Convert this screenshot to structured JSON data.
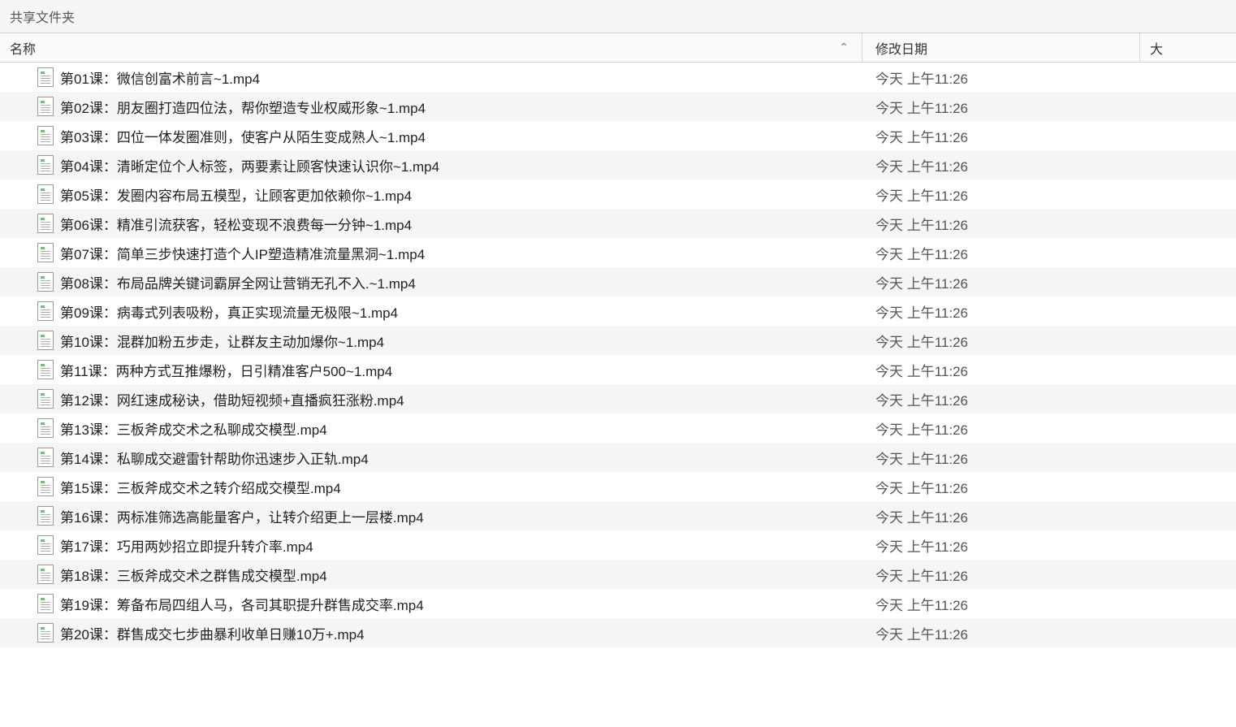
{
  "header": {
    "title": "共享文件夹"
  },
  "columns": {
    "name": "名称",
    "date": "修改日期",
    "size": "大",
    "sort": "⌃"
  },
  "files": [
    {
      "name": "第01课：微信创富术前言~1.mp4",
      "date": "今天 上午11:26"
    },
    {
      "name": "第02课：朋友圈打造四位法，帮你塑造专业权威形象~1.mp4",
      "date": "今天 上午11:26"
    },
    {
      "name": "第03课：四位一体发圈准则，使客户从陌生变成熟人~1.mp4",
      "date": "今天 上午11:26"
    },
    {
      "name": "第04课：清晰定位个人标签，两要素让顾客快速认识你~1.mp4",
      "date": "今天 上午11:26"
    },
    {
      "name": "第05课：发圈内容布局五模型，让顾客更加依赖你~1.mp4",
      "date": "今天 上午11:26"
    },
    {
      "name": "第06课：精准引流获客，轻松变现不浪费每一分钟~1.mp4",
      "date": "今天 上午11:26"
    },
    {
      "name": "第07课：简单三步快速打造个人IP塑造精准流量黑洞~1.mp4",
      "date": "今天 上午11:26"
    },
    {
      "name": "第08课：布局品牌关键词霸屏全网让营销无孔不入.~1.mp4",
      "date": "今天 上午11:26"
    },
    {
      "name": "第09课：病毒式列表吸粉，真正实现流量无极限~1.mp4",
      "date": "今天 上午11:26"
    },
    {
      "name": "第10课：混群加粉五步走，让群友主动加爆你~1.mp4",
      "date": "今天 上午11:26"
    },
    {
      "name": "第11课：两种方式互推爆粉，日引精准客户500~1.mp4",
      "date": "今天 上午11:26"
    },
    {
      "name": "第12课：网红速成秘诀，借助短视频+直播疯狂涨粉.mp4",
      "date": "今天 上午11:26"
    },
    {
      "name": "第13课：三板斧成交术之私聊成交模型.mp4",
      "date": "今天 上午11:26"
    },
    {
      "name": "第14课：私聊成交避雷针帮助你迅速步入正轨.mp4",
      "date": "今天 上午11:26"
    },
    {
      "name": "第15课：三板斧成交术之转介绍成交模型.mp4",
      "date": "今天 上午11:26"
    },
    {
      "name": "第16课：两标准筛选高能量客户，让转介绍更上一层楼.mp4",
      "date": "今天 上午11:26"
    },
    {
      "name": "第17课：巧用两妙招立即提升转介率.mp4",
      "date": "今天 上午11:26"
    },
    {
      "name": "第18课：三板斧成交术之群售成交模型.mp4",
      "date": "今天 上午11:26"
    },
    {
      "name": "第19课：筹备布局四组人马，各司其职提升群售成交率.mp4",
      "date": "今天 上午11:26"
    },
    {
      "name": "第20课：群售成交七步曲暴利收单日赚10万+.mp4",
      "date": "今天 上午11:26"
    }
  ]
}
